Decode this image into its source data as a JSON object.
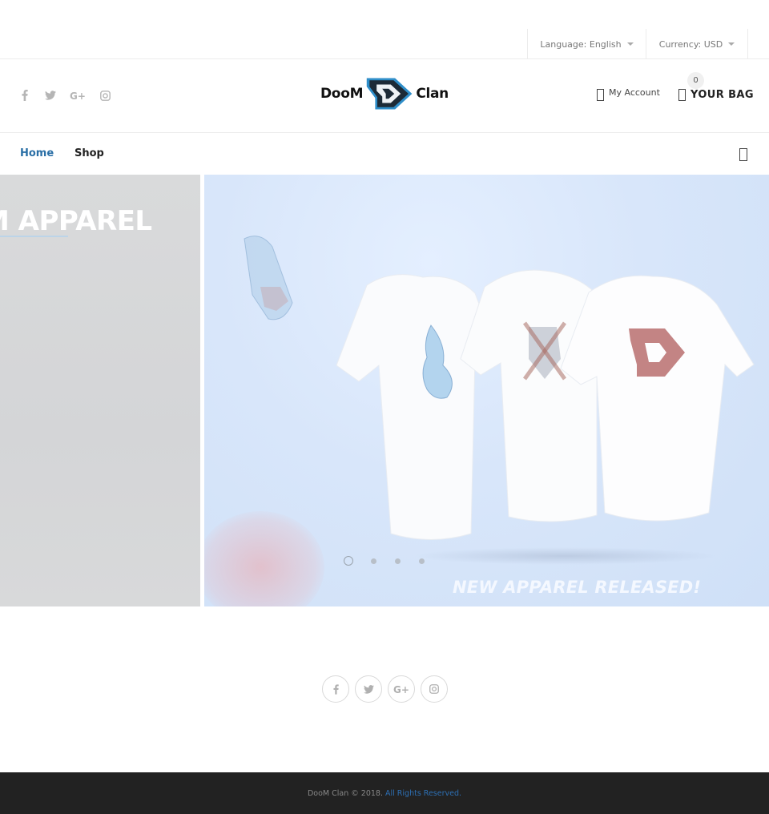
{
  "topbar": {
    "language_label": "Language: English",
    "currency_label": "Currency: USD"
  },
  "header": {
    "social": [
      "facebook-icon",
      "twitter-icon",
      "google-plus-icon",
      "instagram-icon"
    ],
    "logo": {
      "left_word": "DooM",
      "right_word": "Clan"
    },
    "account_label": "My Account",
    "bag_label": "YOUR BAG",
    "bag_count": "0"
  },
  "nav": {
    "items": [
      {
        "label": "Home",
        "active": true
      },
      {
        "label": "Shop",
        "active": false
      }
    ]
  },
  "hero": {
    "prev_slide_title": "M APPAREL",
    "current_slide_caption": "NEW APPAREL RELEASED!",
    "slide_count": 4,
    "active_slide": 1
  },
  "footer": {
    "social": [
      "facebook-icon",
      "twitter-icon",
      "google-plus-icon",
      "instagram-icon"
    ],
    "copyright_text": "DooM Clan © 2018. ",
    "rights_link": "All Rights Reserved."
  },
  "colors": {
    "accent": "#2a6fa6",
    "footer_bg": "#222222",
    "link": "#2d6fb3"
  }
}
